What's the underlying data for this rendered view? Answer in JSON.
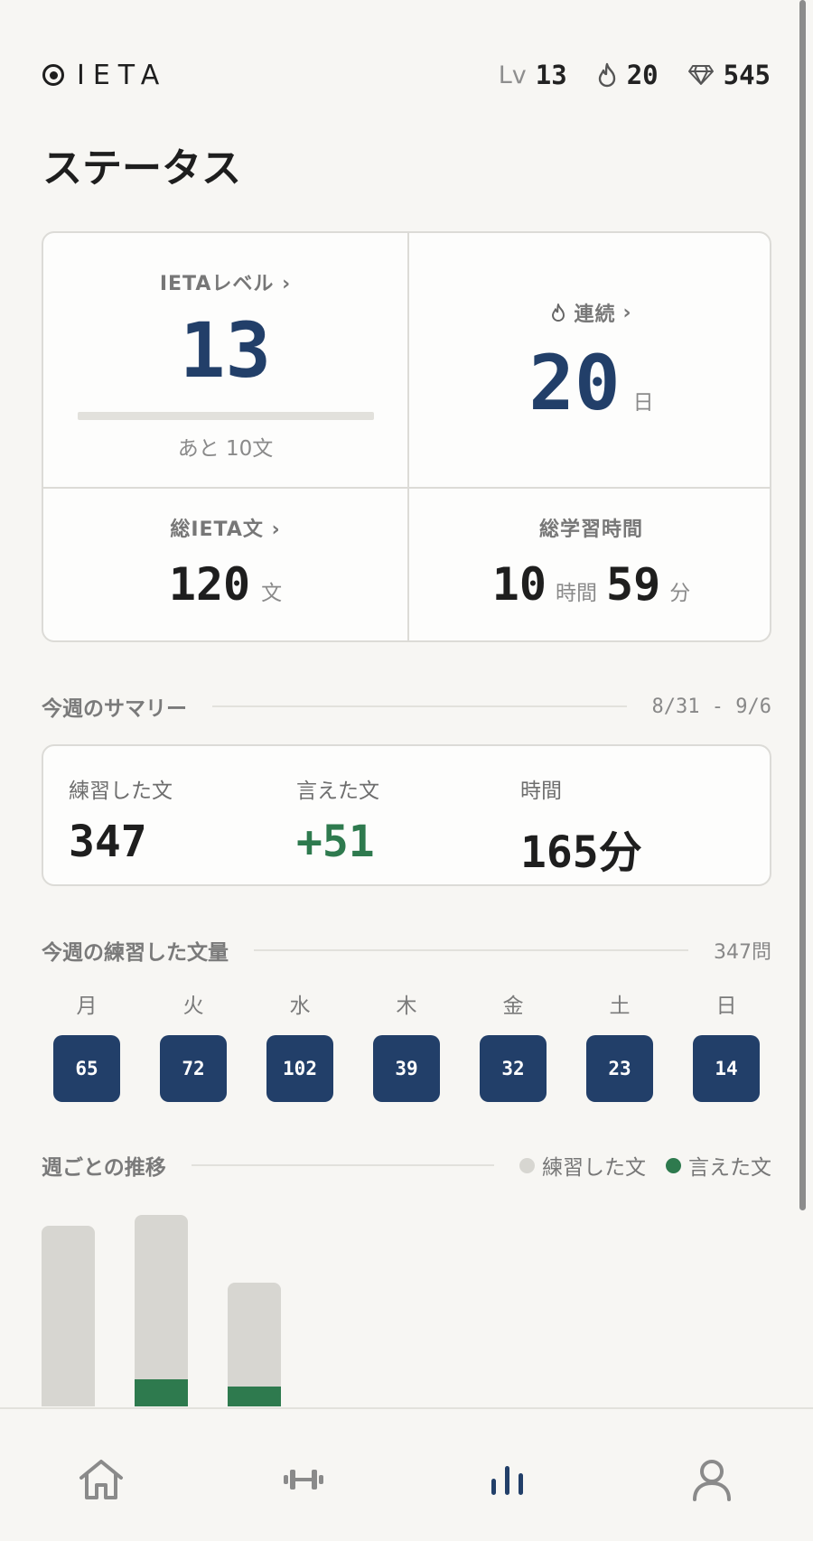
{
  "header": {
    "logo_text": "IETA",
    "level_prefix": "Lv",
    "level": "13",
    "streak": "20",
    "gems": "545"
  },
  "page_title": "ステータス",
  "status": {
    "level_label": "IETAレベル",
    "level_value": "13",
    "level_progress": 0.0,
    "level_remaining": "あと 10文",
    "streak_label": "連続",
    "streak_value": "20",
    "streak_unit": "日",
    "total_label": "総IETA文",
    "total_value": "120",
    "total_unit": "文",
    "time_label": "総学習時間",
    "time_hours": "10",
    "time_hours_unit": "時間",
    "time_minutes": "59",
    "time_minutes_unit": "分"
  },
  "summary": {
    "title": "今週のサマリー",
    "range": "8/31 - 9/6",
    "practiced_label": "練習した文",
    "practiced_value": "347",
    "spoken_label": "言えた文",
    "spoken_value": "+51",
    "time_label": "時間",
    "time_value": "165分"
  },
  "weekly": {
    "title": "今週の練習した文量",
    "total": "347問",
    "days": [
      {
        "name": "月",
        "count": "65"
      },
      {
        "name": "火",
        "count": "72"
      },
      {
        "name": "水",
        "count": "102"
      },
      {
        "name": "木",
        "count": "39"
      },
      {
        "name": "金",
        "count": "32"
      },
      {
        "name": "土",
        "count": "23"
      },
      {
        "name": "日",
        "count": "14"
      }
    ]
  },
  "trend": {
    "title": "週ごとの推移",
    "legend_practiced": "練習した文",
    "legend_spoken": "言えた文"
  },
  "chart_data": {
    "type": "bar",
    "categories": [
      "",
      "",
      ""
    ],
    "series": [
      {
        "name": "練習した文",
        "values": [
          320,
          340,
          220
        ]
      },
      {
        "name": "言えた文",
        "values": [
          0,
          48,
          36
        ]
      }
    ],
    "ylim": [
      0,
      380
    ],
    "colors": {
      "practiced": "#d7d6d1",
      "spoken": "#2e7a4e"
    }
  },
  "colors": {
    "accent": "#223f69",
    "positive": "#2e7a4e",
    "background": "#f7f6f3"
  },
  "nav": {
    "items": [
      "home-icon",
      "dumbbell-icon",
      "stats-icon",
      "user-icon"
    ],
    "active": "stats-icon"
  }
}
